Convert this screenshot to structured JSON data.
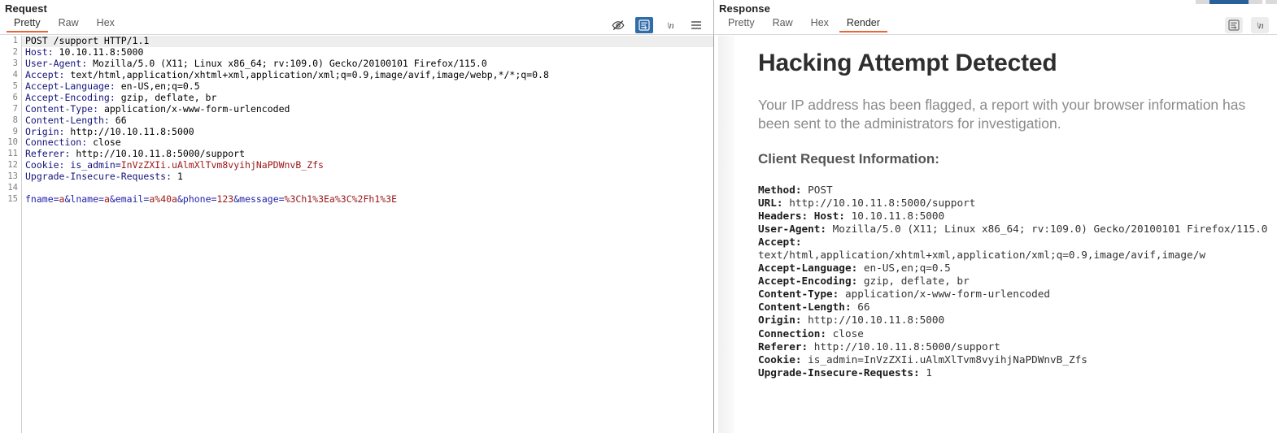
{
  "request": {
    "title": "Request",
    "tabs": [
      {
        "label": "Pretty",
        "active": true
      },
      {
        "label": "Raw",
        "active": false
      },
      {
        "label": "Hex",
        "active": false
      }
    ],
    "tools": [
      {
        "name": "eye-slash-icon",
        "label": "",
        "state": "off"
      },
      {
        "name": "format-text-icon",
        "label": "",
        "state": "on"
      },
      {
        "name": "line-wrap-icon",
        "label": "\\n",
        "state": "off"
      },
      {
        "name": "menu-icon",
        "label": "",
        "state": "off"
      }
    ],
    "line_numbers": [
      "1",
      "2",
      "3",
      "4",
      "5",
      "6",
      "7",
      "8",
      "9",
      "10",
      "11",
      "12",
      "13",
      "14",
      "15"
    ],
    "lines": [
      {
        "n": 1,
        "highlight": true,
        "text": "POST /support HTTP/1.1"
      },
      {
        "n": 2,
        "header": "Host",
        "value": " 10.10.11.8:5000"
      },
      {
        "n": 3,
        "header": "User-Agent",
        "value": " Mozilla/5.0 (X11; Linux x86_64; rv:109.0) Gecko/20100101 Firefox/115.0"
      },
      {
        "n": 4,
        "header": "Accept",
        "value": " text/html,application/xhtml+xml,application/xml;q=0.9,image/avif,image/webp,*/*;q=0.8"
      },
      {
        "n": 5,
        "header": "Accept-Language",
        "value": " en-US,en;q=0.5"
      },
      {
        "n": 6,
        "header": "Accept-Encoding",
        "value": " gzip, deflate, br"
      },
      {
        "n": 7,
        "header": "Content-Type",
        "value": " application/x-www-form-urlencoded"
      },
      {
        "n": 8,
        "header": "Content-Length",
        "value": " 66"
      },
      {
        "n": 9,
        "header": "Origin",
        "value": " http://10.10.11.8:5000"
      },
      {
        "n": 10,
        "header": "Connection",
        "value": " close"
      },
      {
        "n": 11,
        "header": "Referer",
        "value": " http://10.10.11.8:5000/support"
      },
      {
        "n": 12,
        "header": "Cookie",
        "param": " is_admin=",
        "param_value": "InVzZXIi.uAlmXlTvm8vyihjNaPDWnvB_Zfs"
      },
      {
        "n": 13,
        "header": "Upgrade-Insecure-Requests",
        "value": " 1"
      },
      {
        "n": 14,
        "text": ""
      },
      {
        "n": 15,
        "body": [
          {
            "k": "fname=",
            "v": "a"
          },
          {
            "k": "&lname=",
            "v": "a"
          },
          {
            "k": "&email=",
            "v": "a%40a"
          },
          {
            "k": "&phone=",
            "v": "123"
          },
          {
            "k": "&message=",
            "v": "%3Ch1%3Ea%3C%2Fh1%3E"
          }
        ]
      }
    ]
  },
  "response": {
    "title": "Response",
    "tabs": [
      {
        "label": "Pretty",
        "active": false
      },
      {
        "label": "Raw",
        "active": false
      },
      {
        "label": "Hex",
        "active": false
      },
      {
        "label": "Render",
        "active": true
      }
    ],
    "tools": [
      {
        "name": "format-text-icon",
        "label": "",
        "state": "chip"
      },
      {
        "name": "line-wrap-icon",
        "label": "\\n",
        "state": "chip"
      }
    ],
    "render": {
      "heading": "Hacking Attempt Detected",
      "lead": "Your IP address has been flagged, a report with your browser information has been sent to the administrators for investigation.",
      "subheading": "Client Request Information:",
      "fields": [
        {
          "label": "Method:",
          "value": " POST"
        },
        {
          "label": "URL:",
          "value": " http://10.10.11.8:5000/support"
        },
        {
          "label": "Headers: Host:",
          "value": " 10.10.11.8:5000",
          "label_bold_all": true
        },
        {
          "label": "User-Agent:",
          "value": " Mozilla/5.0 (X11; Linux x86_64; rv:109.0) Gecko/20100101 Firefox/115.0"
        },
        {
          "label": "Accept:",
          "value": "text/html,application/xhtml+xml,application/xml;q=0.9,image/avif,image/w",
          "newline": true
        },
        {
          "label": "Accept-Language:",
          "value": " en-US,en;q=0.5"
        },
        {
          "label": "Accept-Encoding:",
          "value": " gzip, deflate, br"
        },
        {
          "label": "Content-Type:",
          "value": " application/x-www-form-urlencoded"
        },
        {
          "label": "Content-Length:",
          "value": " 66"
        },
        {
          "label": "Origin:",
          "value": " http://10.10.11.8:5000"
        },
        {
          "label": "Connection:",
          "value": " close"
        },
        {
          "label": "Referer:",
          "value": " http://10.10.11.8:5000/support"
        },
        {
          "label": "Cookie:",
          "value": " is_admin=InVzZXIi.uAlmXlTvm8vyihjNaPDWnvB_Zfs"
        },
        {
          "label": "Upgrade-Insecure-Requests:",
          "value": " 1"
        }
      ]
    }
  },
  "colors": {
    "accent": "#e8663b",
    "header_blue": "#13137a",
    "value_red": "#9a1616",
    "tool_active": "#2f6ca8",
    "progress": "#2a6099"
  }
}
